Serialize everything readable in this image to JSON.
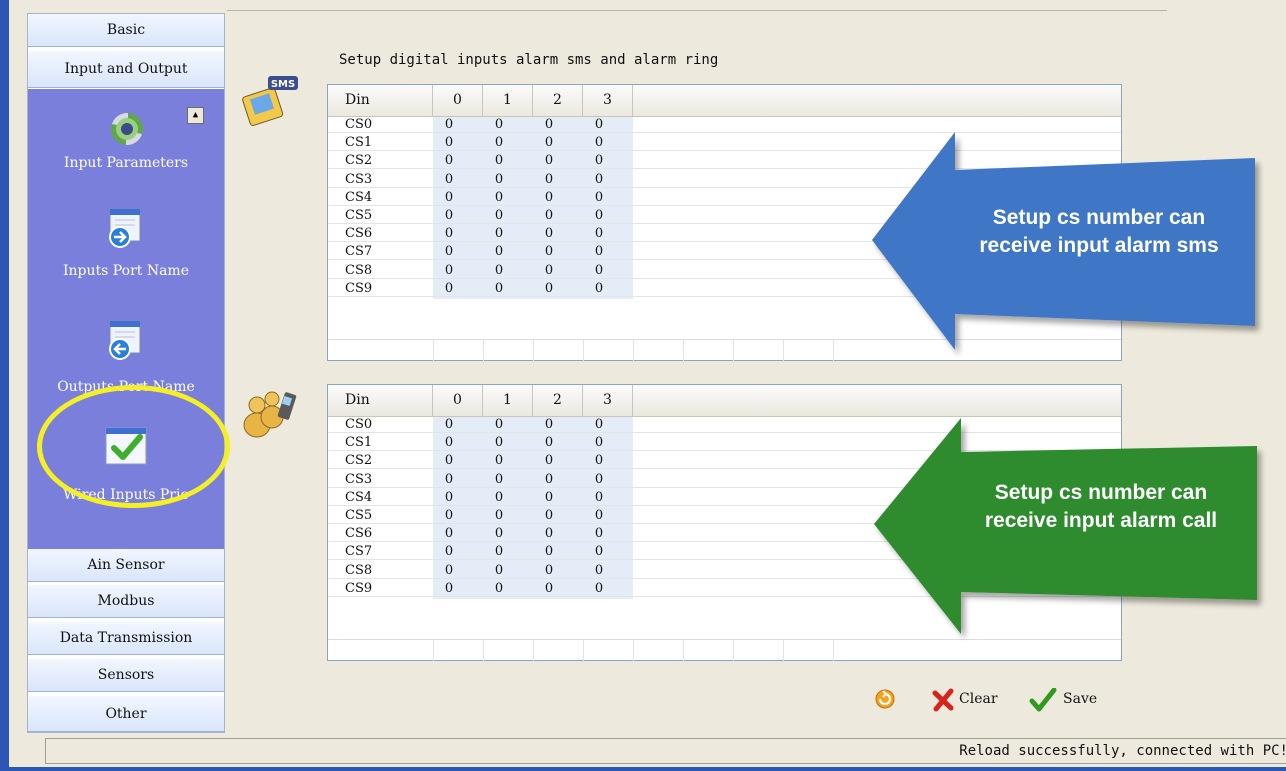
{
  "sidebar": {
    "top_buttons": [
      "Basic",
      "Input and Output"
    ],
    "panel_items": [
      "Input Parameters",
      "Inputs Port Name",
      "Outputs Port Name",
      "Wired Inputs Prio"
    ],
    "bottom_buttons": [
      "Ain Sensor",
      "Modbus",
      "Data Transmission",
      "Sensors",
      "Other"
    ]
  },
  "main": {
    "heading": "Setup digital inputs alarm sms and alarm ring",
    "sms_grid": {
      "columns": [
        "Din",
        "0",
        "1",
        "2",
        "3"
      ],
      "rows": [
        {
          "name": "CS0",
          "values": [
            "0",
            "0",
            "0",
            "0"
          ]
        },
        {
          "name": "CS1",
          "values": [
            "0",
            "0",
            "0",
            "0"
          ]
        },
        {
          "name": "CS2",
          "values": [
            "0",
            "0",
            "0",
            "0"
          ]
        },
        {
          "name": "CS3",
          "values": [
            "0",
            "0",
            "0",
            "0"
          ]
        },
        {
          "name": "CS4",
          "values": [
            "0",
            "0",
            "0",
            "0"
          ]
        },
        {
          "name": "CS5",
          "values": [
            "0",
            "0",
            "0",
            "0"
          ]
        },
        {
          "name": "CS6",
          "values": [
            "0",
            "0",
            "0",
            "0"
          ]
        },
        {
          "name": "CS7",
          "values": [
            "0",
            "0",
            "0",
            "0"
          ]
        },
        {
          "name": "CS8",
          "values": [
            "0",
            "0",
            "0",
            "0"
          ]
        },
        {
          "name": "CS9",
          "values": [
            "0",
            "0",
            "0",
            "0"
          ]
        }
      ]
    },
    "ring_grid": {
      "columns": [
        "Din",
        "0",
        "1",
        "2",
        "3"
      ],
      "rows": [
        {
          "name": "CS0",
          "values": [
            "0",
            "0",
            "0",
            "0"
          ]
        },
        {
          "name": "CS1",
          "values": [
            "0",
            "0",
            "0",
            "0"
          ]
        },
        {
          "name": "CS2",
          "values": [
            "0",
            "0",
            "0",
            "0"
          ]
        },
        {
          "name": "CS3",
          "values": [
            "0",
            "0",
            "0",
            "0"
          ]
        },
        {
          "name": "CS4",
          "values": [
            "0",
            "0",
            "0",
            "0"
          ]
        },
        {
          "name": "CS5",
          "values": [
            "0",
            "0",
            "0",
            "0"
          ]
        },
        {
          "name": "CS6",
          "values": [
            "0",
            "0",
            "0",
            "0"
          ]
        },
        {
          "name": "CS7",
          "values": [
            "0",
            "0",
            "0",
            "0"
          ]
        },
        {
          "name": "CS8",
          "values": [
            "0",
            "0",
            "0",
            "0"
          ]
        },
        {
          "name": "CS9",
          "values": [
            "0",
            "0",
            "0",
            "0"
          ]
        }
      ]
    }
  },
  "callouts": {
    "sms": {
      "line1": "Setup cs number can",
      "line2": "receive input alarm sms",
      "color": "#3f76c6"
    },
    "call": {
      "line1": "Setup cs number can",
      "line2": "receive input alarm call",
      "color": "#2e8b2e"
    }
  },
  "toolbar": {
    "clear_label": "Clear",
    "save_label": "Save"
  },
  "status": {
    "message": "Reload successfully, connected with PC!"
  },
  "colors": {
    "frame": "#2b56b4",
    "panel": "#7b7fdc",
    "highlight": "#f5f023"
  },
  "icons": [
    "input-parameters-icon",
    "inputs-port-name-icon",
    "outputs-port-name-icon",
    "wired-inputs-prio-icon",
    "sms-phone-icon",
    "people-phone-icon",
    "reload-icon",
    "clear-x-icon",
    "save-check-icon"
  ]
}
